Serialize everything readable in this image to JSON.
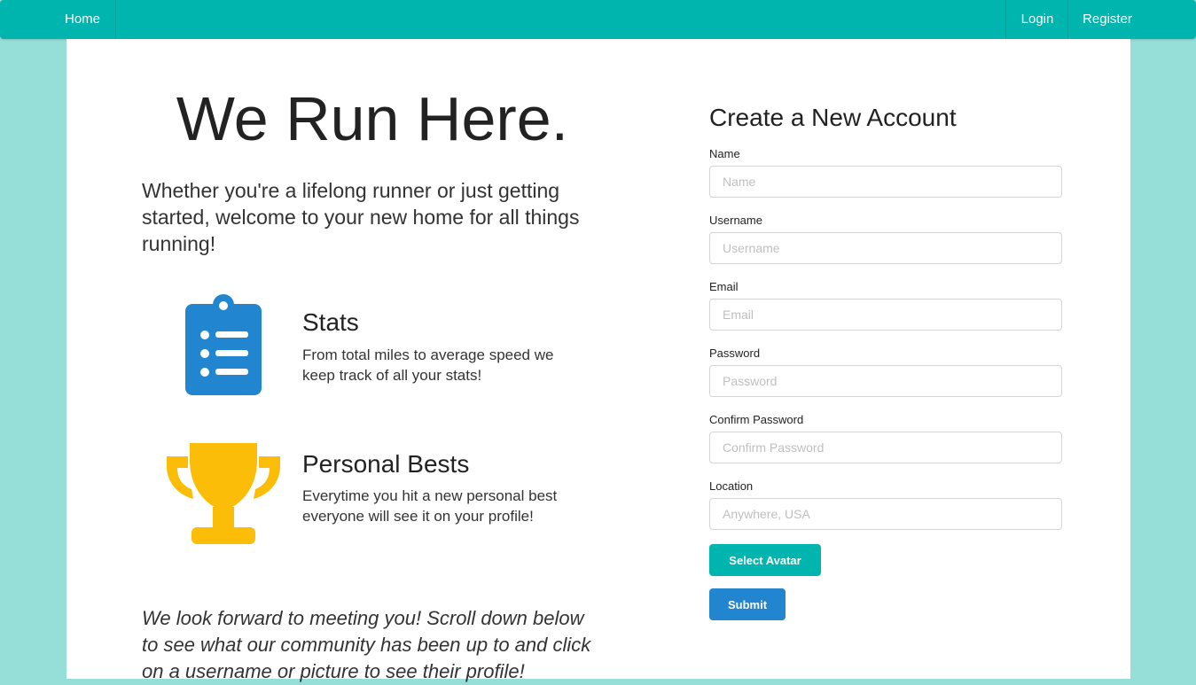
{
  "nav": {
    "home": "Home",
    "login": "Login",
    "register": "Register"
  },
  "hero": {
    "title": "We Run Here.",
    "intro": "Whether you're a lifelong runner or just getting started, welcome to your new home for all things running!"
  },
  "features": [
    {
      "icon": "clipboard-list-icon",
      "title": "Stats",
      "description": "From total miles to average speed we keep track of all your stats!"
    },
    {
      "icon": "trophy-icon",
      "title": "Personal Bests",
      "description": "Everytime you hit a new personal best everyone will see it on your profile!"
    }
  ],
  "closing": "We look forward to meeting you! Scroll down below to see what our community has been up to and click on a username or picture to see their profile!",
  "form": {
    "title": "Create a New Account",
    "fields": [
      {
        "label": "Name",
        "placeholder": "Name",
        "value": ""
      },
      {
        "label": "Username",
        "placeholder": "Username",
        "value": ""
      },
      {
        "label": "Email",
        "placeholder": "Email",
        "value": ""
      },
      {
        "label": "Password",
        "placeholder": "Password",
        "value": ""
      },
      {
        "label": "Confirm Password",
        "placeholder": "Confirm Password",
        "value": ""
      },
      {
        "label": "Location",
        "placeholder": "Anywhere, USA",
        "value": ""
      }
    ],
    "select_avatar": "Select Avatar",
    "submit": "Submit"
  },
  "colors": {
    "primary_teal": "#00b5ad",
    "background_teal": "#96ded8",
    "submit_blue": "#2185d0",
    "stats_icon_blue": "#2185d0",
    "trophy_icon_yellow": "#fbbd08"
  }
}
